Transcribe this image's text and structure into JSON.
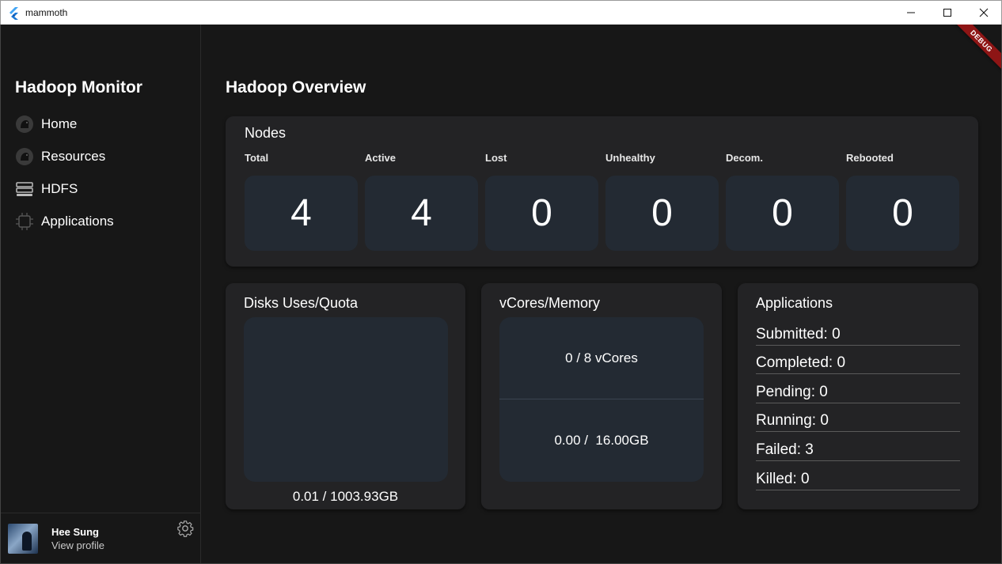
{
  "window": {
    "title": "mammoth",
    "controls": {
      "minimize": "—",
      "maximize": "☐",
      "close": "✕"
    }
  },
  "debug_banner": "DEBUG",
  "sidebar": {
    "brand": "Hadoop Monitor",
    "items": [
      {
        "label": "Home",
        "icon": "elephant-icon"
      },
      {
        "label": "Resources",
        "icon": "elephant-icon"
      },
      {
        "label": "HDFS",
        "icon": "storage-icon"
      },
      {
        "label": "Applications",
        "icon": "chip-icon"
      }
    ],
    "profile": {
      "name": "Hee Sung",
      "link": "View profile"
    }
  },
  "main": {
    "title": "Hadoop Overview",
    "nodes": {
      "title": "Nodes",
      "stats": [
        {
          "label": "Total",
          "value": "4"
        },
        {
          "label": "Active",
          "value": "4"
        },
        {
          "label": "Lost",
          "value": "0"
        },
        {
          "label": "Unhealthy",
          "value": "0"
        },
        {
          "label": "Decom.",
          "value": "0"
        },
        {
          "label": "Rebooted",
          "value": "0"
        }
      ]
    },
    "disks": {
      "title": "Disks Uses/Quota",
      "value": "0.01 / 1003.93GB"
    },
    "vcores": {
      "title": "vCores/Memory",
      "cores": "0 / 8 vCores",
      "memory": "0.00 /  16.00GB"
    },
    "applications": {
      "title": "Applications",
      "rows": [
        "Submitted: 0",
        "Completed: 0",
        "Pending: 0",
        "Running: 0",
        "Failed: 3",
        "Killed: 0"
      ]
    }
  },
  "colors": {
    "background": "#171717",
    "card": "#232325",
    "tile": "#232a33",
    "debug": "#8e1515"
  }
}
